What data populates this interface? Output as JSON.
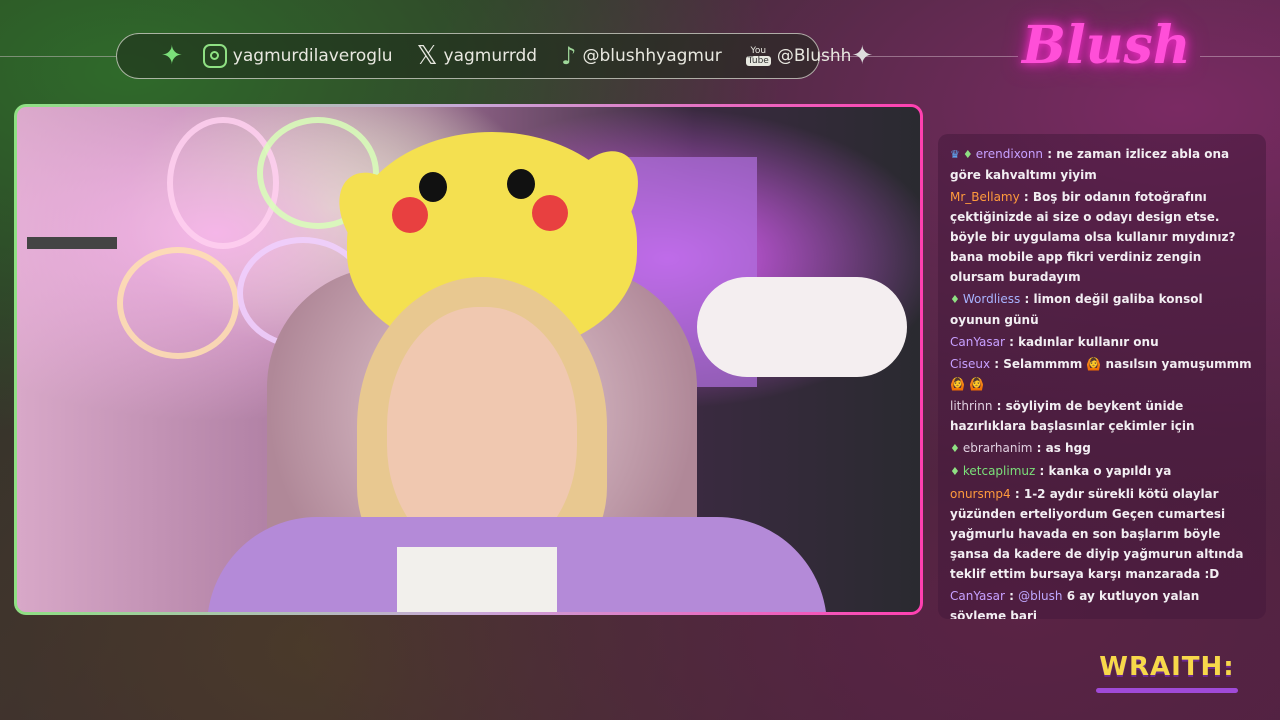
{
  "social": {
    "instagram": "yagmurdilaveroglu",
    "x": "yagmurrdd",
    "tiktok": "@blushhyagmur",
    "youtube_badge_top": "You",
    "youtube_badge_bottom": "Tube",
    "youtube": "@Blushh"
  },
  "logo": {
    "text": "Blush"
  },
  "chat": {
    "messages": [
      {
        "badges": [
          "prime",
          "sub"
        ],
        "user": "erendixonn",
        "user_color": "#c7a0ff",
        "text": "ne zaman izlicez abla ona göre kahvaltımı yiyim"
      },
      {
        "badges": [],
        "user": "Mr_Bellamy",
        "user_color": "#ff9a3c",
        "text": "Boş bir odanın fotoğrafını çektiğinizde ai size o odayı design etse. böyle bir uygulama olsa kullanır mıydınız? bana mobile app fikri verdiniz zengin olursam buradayım"
      },
      {
        "badges": [
          "sub"
        ],
        "user": "Wordliess",
        "user_color": "#a8b4ff",
        "text": "limon değil galiba konsol oyunun günü"
      },
      {
        "badges": [],
        "user": "CanYasar",
        "user_color": "#c7a0ff",
        "text": "kadınlar kullanır onu"
      },
      {
        "badges": [],
        "user": "Ciseux",
        "user_color": "#c7a0ff",
        "text": "Selammmm 🙆 nasılsın yamuşummm 🙆 🙆"
      },
      {
        "badges": [],
        "user": "lithrinn",
        "user_color": "#e0d0e0",
        "text": "söyliyim de beykent ünide hazırlıklara başlasınlar çekimler için"
      },
      {
        "badges": [
          "sub"
        ],
        "user": "ebrarhanim",
        "user_color": "#e0d0e0",
        "text": "as hgg"
      },
      {
        "badges": [
          "sub"
        ],
        "user": "ketcaplimuz",
        "user_color": "#7be07a",
        "text": "kanka o yapıldı ya"
      },
      {
        "badges": [],
        "user": "onursmp4",
        "user_color": "#ff9a3c",
        "text": "1-2 aydır sürekli kötü olaylar yüzünden erteliyordum Geçen cumartesi yağmurlu havada en son başlarım böyle şansa da kadere de diyip yağmurun altında teklif ettim bursaya karşı manzarada :D"
      },
      {
        "badges": [],
        "user": "CanYasar",
        "user_color": "#c7a0ff",
        "mention": "@blush",
        "text": "6 ay kutluyon yalan söyleme bari"
      }
    ]
  },
  "sponsor": {
    "text": "WRAITH:"
  },
  "colors": {
    "accent_green": "#8fe083",
    "accent_pink": "#ff3fb0",
    "sponsor_yellow": "#f7d84a"
  }
}
